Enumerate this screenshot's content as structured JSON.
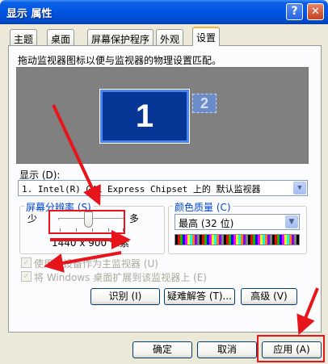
{
  "window": {
    "title": "显示 属性",
    "help_glyph": "?",
    "close_glyph": "✕"
  },
  "tabs": [
    {
      "label": "主题"
    },
    {
      "label": "桌面"
    },
    {
      "label": "屏幕保护程序"
    },
    {
      "label": "外观"
    },
    {
      "label": "设置"
    }
  ],
  "settings": {
    "instruction": "拖动监视器图标以便与监视器的物理设置匹配。",
    "monitor_1": "1",
    "monitor_2": "2",
    "display_label": "显示 (D):",
    "display_value": "1. Intel(R) G41 Express Chipset 上的 默认监视器",
    "resolution": {
      "title": "屏幕分辨率 (S)",
      "less": "少",
      "more": "多",
      "value_text": "1440 x 900 像素",
      "slider_position": 0.45
    },
    "color": {
      "title": "颜色质量 (C)",
      "value": "最高 (32 位)"
    },
    "check_primary": "使用该设备作为主监视器 (U)",
    "check_extend": "将 Windows 桌面扩展到该监视器上 (E)",
    "btn_identify": "识别 (I)",
    "btn_troubleshoot": "疑难解答 (T)...",
    "btn_advanced": "高级 (V)"
  },
  "footer": {
    "ok": "确定",
    "cancel": "取消",
    "apply": "应用 (A)"
  },
  "colors": {
    "annotation_red": "#E8141C",
    "titlebar_blue": "#0054E3",
    "tab_active_accent": "#F7B439"
  },
  "icons": {
    "dropdown": "▼",
    "check": "✓"
  }
}
